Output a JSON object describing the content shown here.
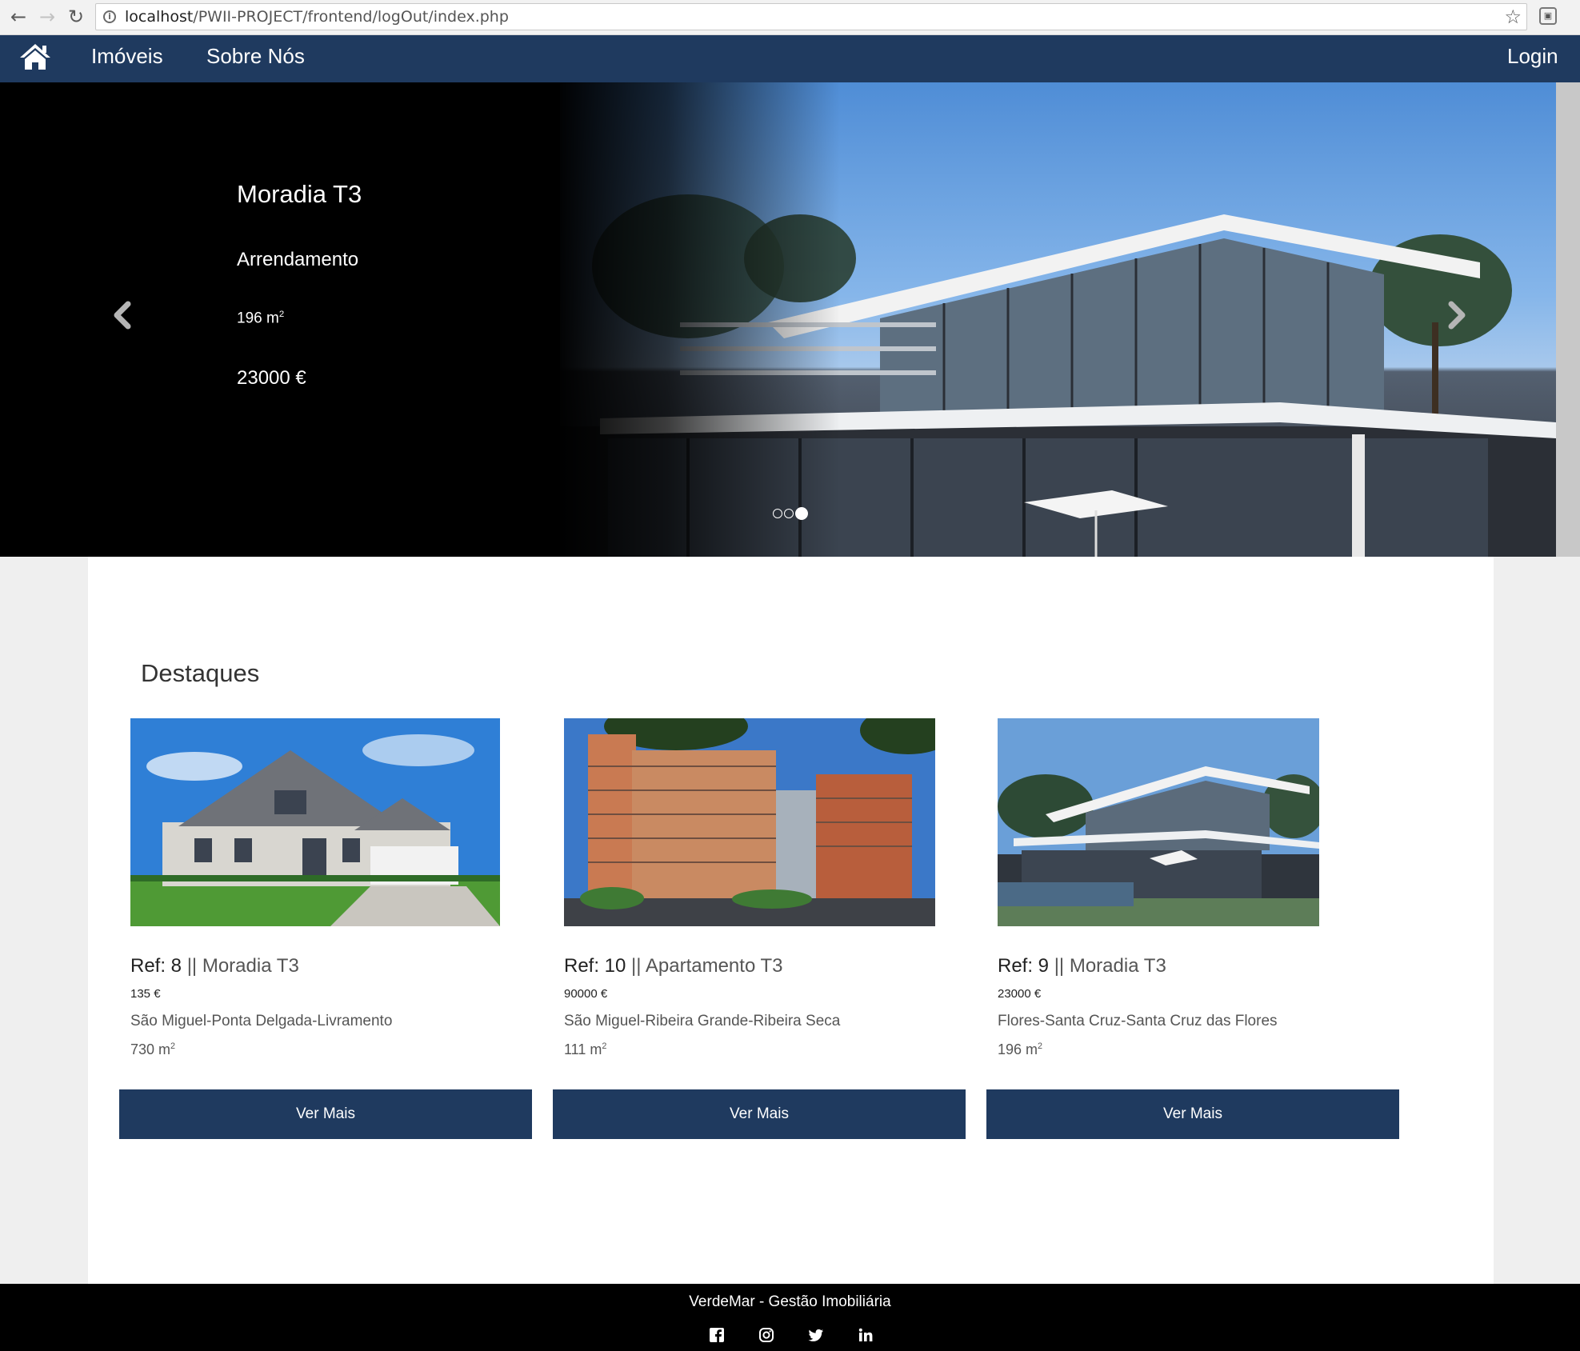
{
  "browser": {
    "url_host": "localhost",
    "url_path": "/PWII-PROJECT/frontend/logOut/index.php"
  },
  "nav": {
    "links": [
      "Imóveis",
      "Sobre Nós"
    ],
    "login": "Login"
  },
  "hero": {
    "title": "Moradia T3",
    "type": "Arrendamento",
    "area": "196 m",
    "area_sup": "2",
    "price": "23000 €",
    "slides": 3,
    "active_slide": 3
  },
  "featured": {
    "title": "Destaques",
    "button_label": "Ver Mais",
    "cards": [
      {
        "ref": "Ref: 8",
        "sep": " || ",
        "name": "Moradia T3",
        "price": "135 €",
        "location": "São Miguel-Ponta Delgada-Livramento",
        "area": "730 m",
        "area_sup": "2",
        "image": "suburban-house-photo"
      },
      {
        "ref": "Ref: 10",
        "sep": " || ",
        "name": "Apartamento T3",
        "price": "90000 €",
        "location": "São Miguel-Ribeira Grande-Ribeira Seca",
        "area": "111 m",
        "area_sup": "2",
        "image": "apartment-building-photo"
      },
      {
        "ref": "Ref: 9",
        "sep": " || ",
        "name": "Moradia T3",
        "price": "23000 €",
        "location": "Flores-Santa Cruz-Santa Cruz das Flores",
        "area": "196 m",
        "area_sup": "2",
        "image": "modern-villa-photo"
      }
    ]
  },
  "footer": {
    "title": "VerdeMar - Gestão Imobiliária",
    "social": [
      "facebook-icon",
      "instagram-icon",
      "twitter-icon",
      "linkedin-icon"
    ]
  },
  "colors": {
    "brand": "#1f3a5f",
    "footer": "#000000"
  }
}
